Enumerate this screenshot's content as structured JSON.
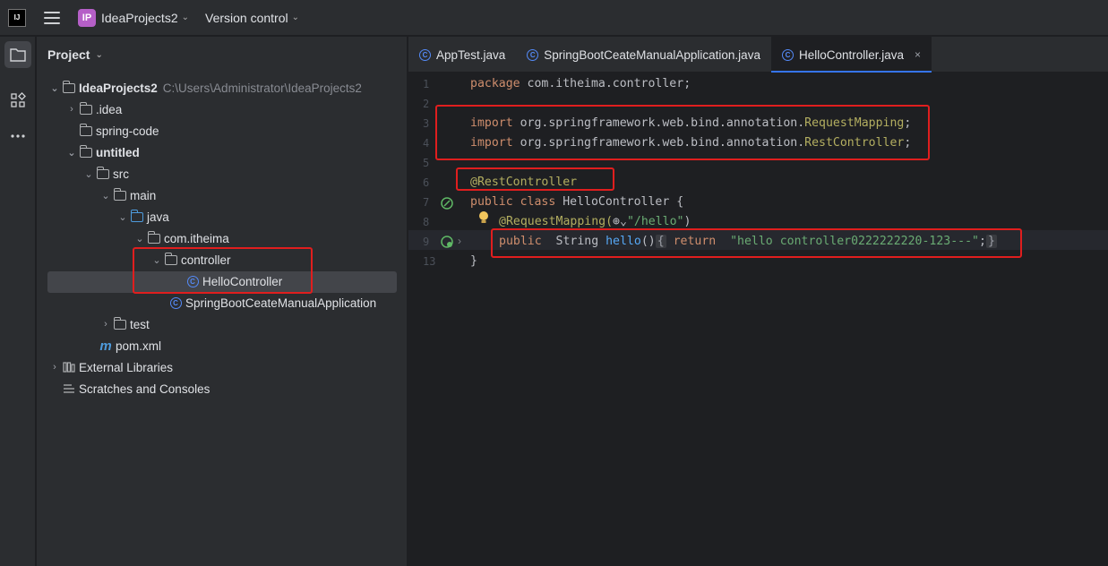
{
  "titlebar": {
    "logo_text": "IJ",
    "project_badge": "IP",
    "project_name": "IdeaProjects2",
    "vcs_label": "Version control"
  },
  "project_panel": {
    "header": "Project",
    "tree": [
      {
        "label": "IdeaProjects2",
        "path": "C:\\Users\\Administrator\\IdeaProjects2",
        "icon": "module-folder-icon",
        "expanded": true
      },
      {
        "label": ".idea",
        "icon": "folder-icon",
        "expanded": false
      },
      {
        "label": "spring-code",
        "icon": "folder-icon"
      },
      {
        "label": "untitled",
        "icon": "module-folder-icon",
        "expanded": true
      },
      {
        "label": "src",
        "icon": "folder-icon",
        "expanded": true
      },
      {
        "label": "main",
        "icon": "folder-icon",
        "expanded": true
      },
      {
        "label": "java",
        "icon": "source-folder-icon",
        "expanded": true
      },
      {
        "label": "com.itheima",
        "icon": "package-icon",
        "expanded": true
      },
      {
        "label": "controller",
        "icon": "package-icon",
        "expanded": true
      },
      {
        "label": "HelloController",
        "icon": "class-icon",
        "selected": true
      },
      {
        "label": "SpringBootCeateManualApplication",
        "icon": "spring-class-icon"
      },
      {
        "label": "test",
        "icon": "folder-icon",
        "expanded": false
      },
      {
        "label": "pom.xml",
        "icon": "maven-icon"
      },
      {
        "label": "External Libraries",
        "icon": "libraries-icon",
        "expanded": false
      },
      {
        "label": "Scratches and Consoles",
        "icon": "scratches-icon"
      }
    ]
  },
  "editor": {
    "tabs": [
      {
        "label": "AppTest.java",
        "icon": "class-icon",
        "active": false
      },
      {
        "label": "SpringBootCeateManualApplication.java",
        "icon": "spring-class-icon",
        "active": false
      },
      {
        "label": "HelloController.java",
        "icon": "class-icon",
        "active": true,
        "close": "×"
      }
    ],
    "line_numbers": [
      "1",
      "2",
      "3",
      "4",
      "5",
      "6",
      "7",
      "8",
      "9",
      "13"
    ],
    "code": {
      "l1_kw": "package",
      "l1_rest": " com.itheima.controller;",
      "l3_kw": "import",
      "l3_pkg": " org.springframework.web.bind.annotation.",
      "l3_cls": "RequestMapping",
      "l3_end": ";",
      "l4_kw": "import",
      "l4_pkg": " org.springframework.web.bind.annotation.",
      "l4_cls": "RestController",
      "l4_end": ";",
      "l6_ann": "@RestController",
      "l7_kw": "public class",
      "l7_rest": " HelloController {",
      "l8_ann": "@RequestMapping(",
      "l8_str": "\"/hello\"",
      "l8_end": ")",
      "l9_kw": "public",
      "l9_type": "  String ",
      "l9_fn": "hello",
      "l9_paren": "()",
      "l9_fold1": "{",
      "l9_ret": " return",
      "l9_str": "  \"hello controller0222222220-123---\"",
      "l9_semi": ";",
      "l9_fold2": "}",
      "l13": "}"
    }
  },
  "colors": {
    "accent": "#3574f0",
    "highlight_box": "#e01e1e",
    "keyword": "#cf8e6d",
    "annotation": "#b3ae60",
    "string": "#6aab73",
    "method": "#56a8f5"
  }
}
